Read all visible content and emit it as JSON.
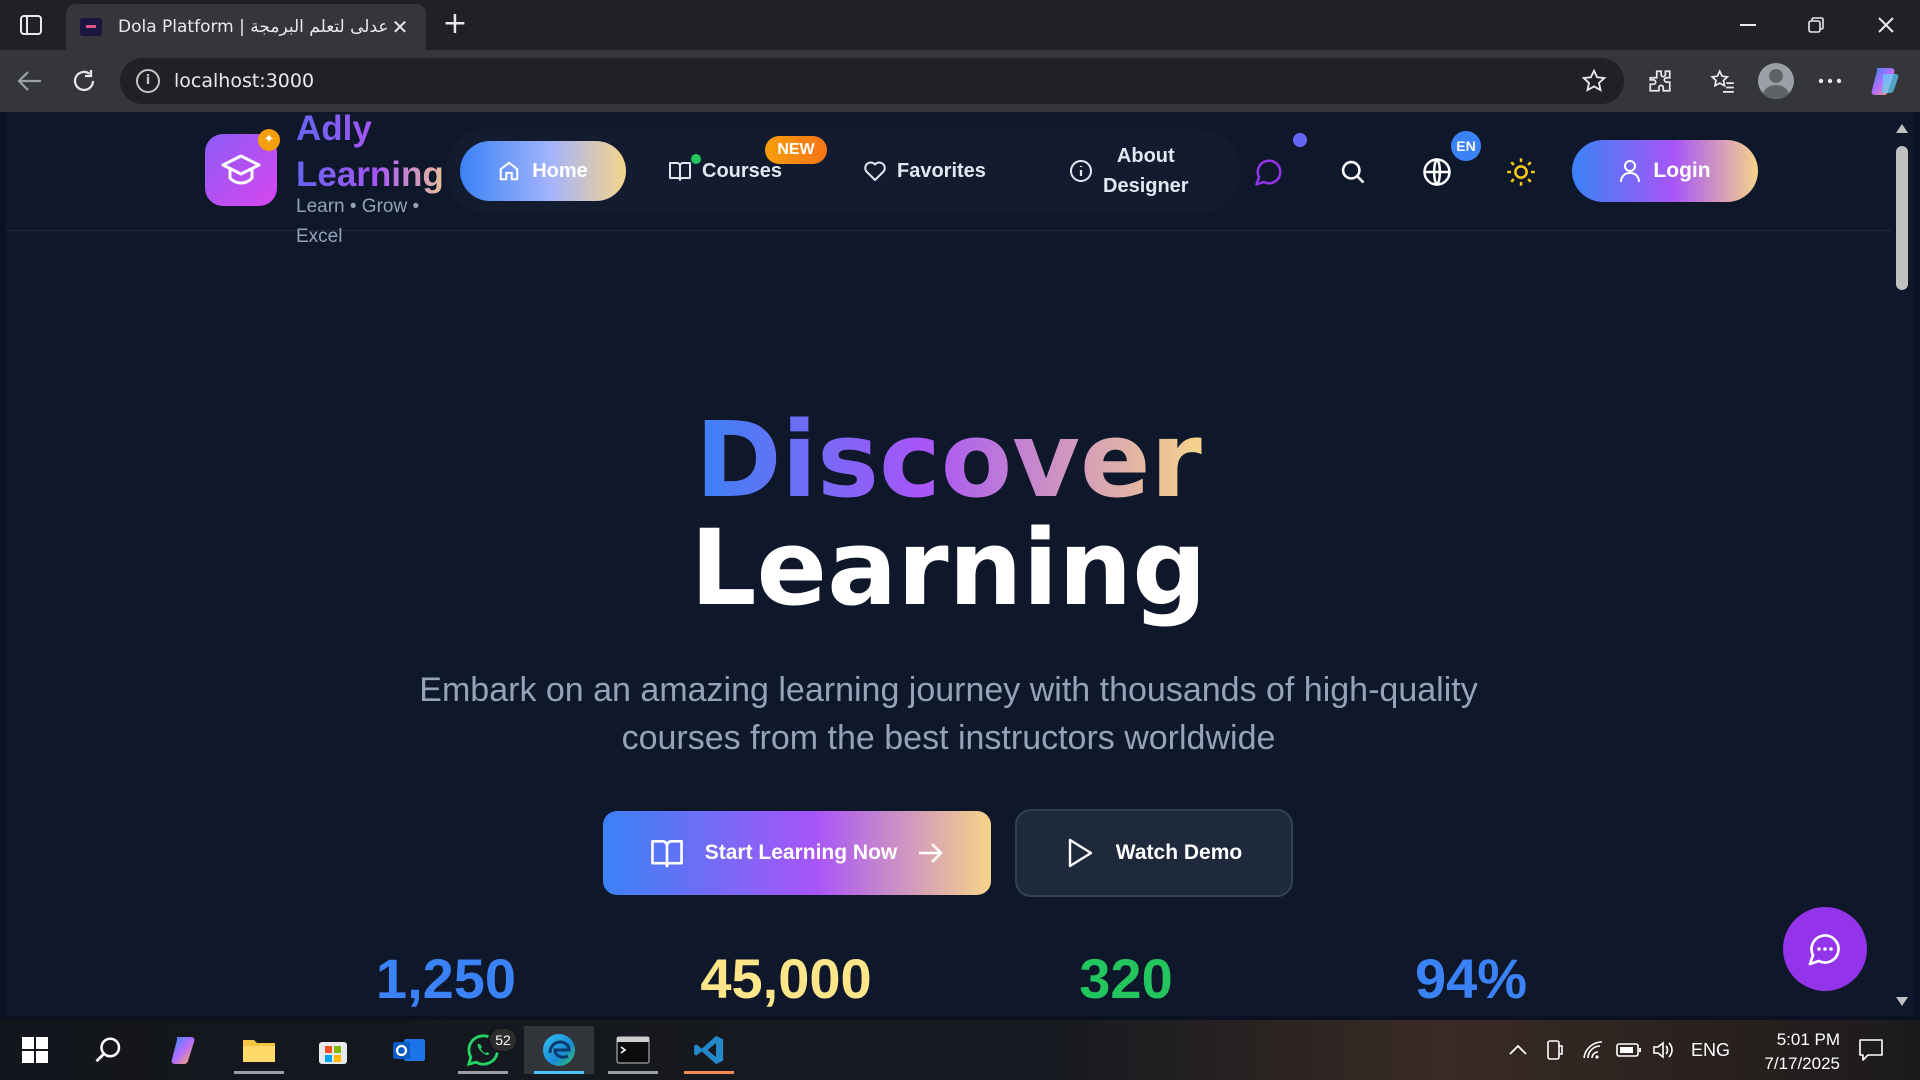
{
  "browser": {
    "tab_title": "Dola Platform | عدلى لتعلم البرمجة",
    "url": "localhost:3000"
  },
  "header": {
    "brand_name": "Adly Learning",
    "brand_tagline": "Learn • Grow • Excel",
    "nav": {
      "home": "Home",
      "courses": "Courses",
      "courses_badge": "NEW",
      "favorites": "Favorites",
      "about_line1": "About",
      "about_line2": "Designer"
    },
    "language_badge": "EN",
    "login_label": "Login"
  },
  "hero": {
    "title_line1": "Discover",
    "title_line2": "Learning",
    "subtitle": "Embark on an amazing learning journey with thousands of high-quality courses from the best instructors worldwide",
    "primary_cta": "Start Learning Now",
    "secondary_cta": "Watch Demo"
  },
  "stats": [
    {
      "value": "1,250",
      "color": "#3b82f6"
    },
    {
      "value": "45,000",
      "color": "#fde68a"
    },
    {
      "value": "320",
      "color": "#22c55e"
    },
    {
      "value": "94%",
      "color": "#3b82f6"
    }
  ],
  "taskbar": {
    "whatsapp_badge": "52",
    "language": "ENG",
    "time": "5:01 PM",
    "date": "7/17/2025"
  },
  "colors": {
    "page_bg": "#0f172a",
    "accent_blue": "#3b82f6",
    "accent_purple": "#a855f7",
    "accent_gold": "#f5d48a",
    "chat_fab": "#9333ea"
  }
}
